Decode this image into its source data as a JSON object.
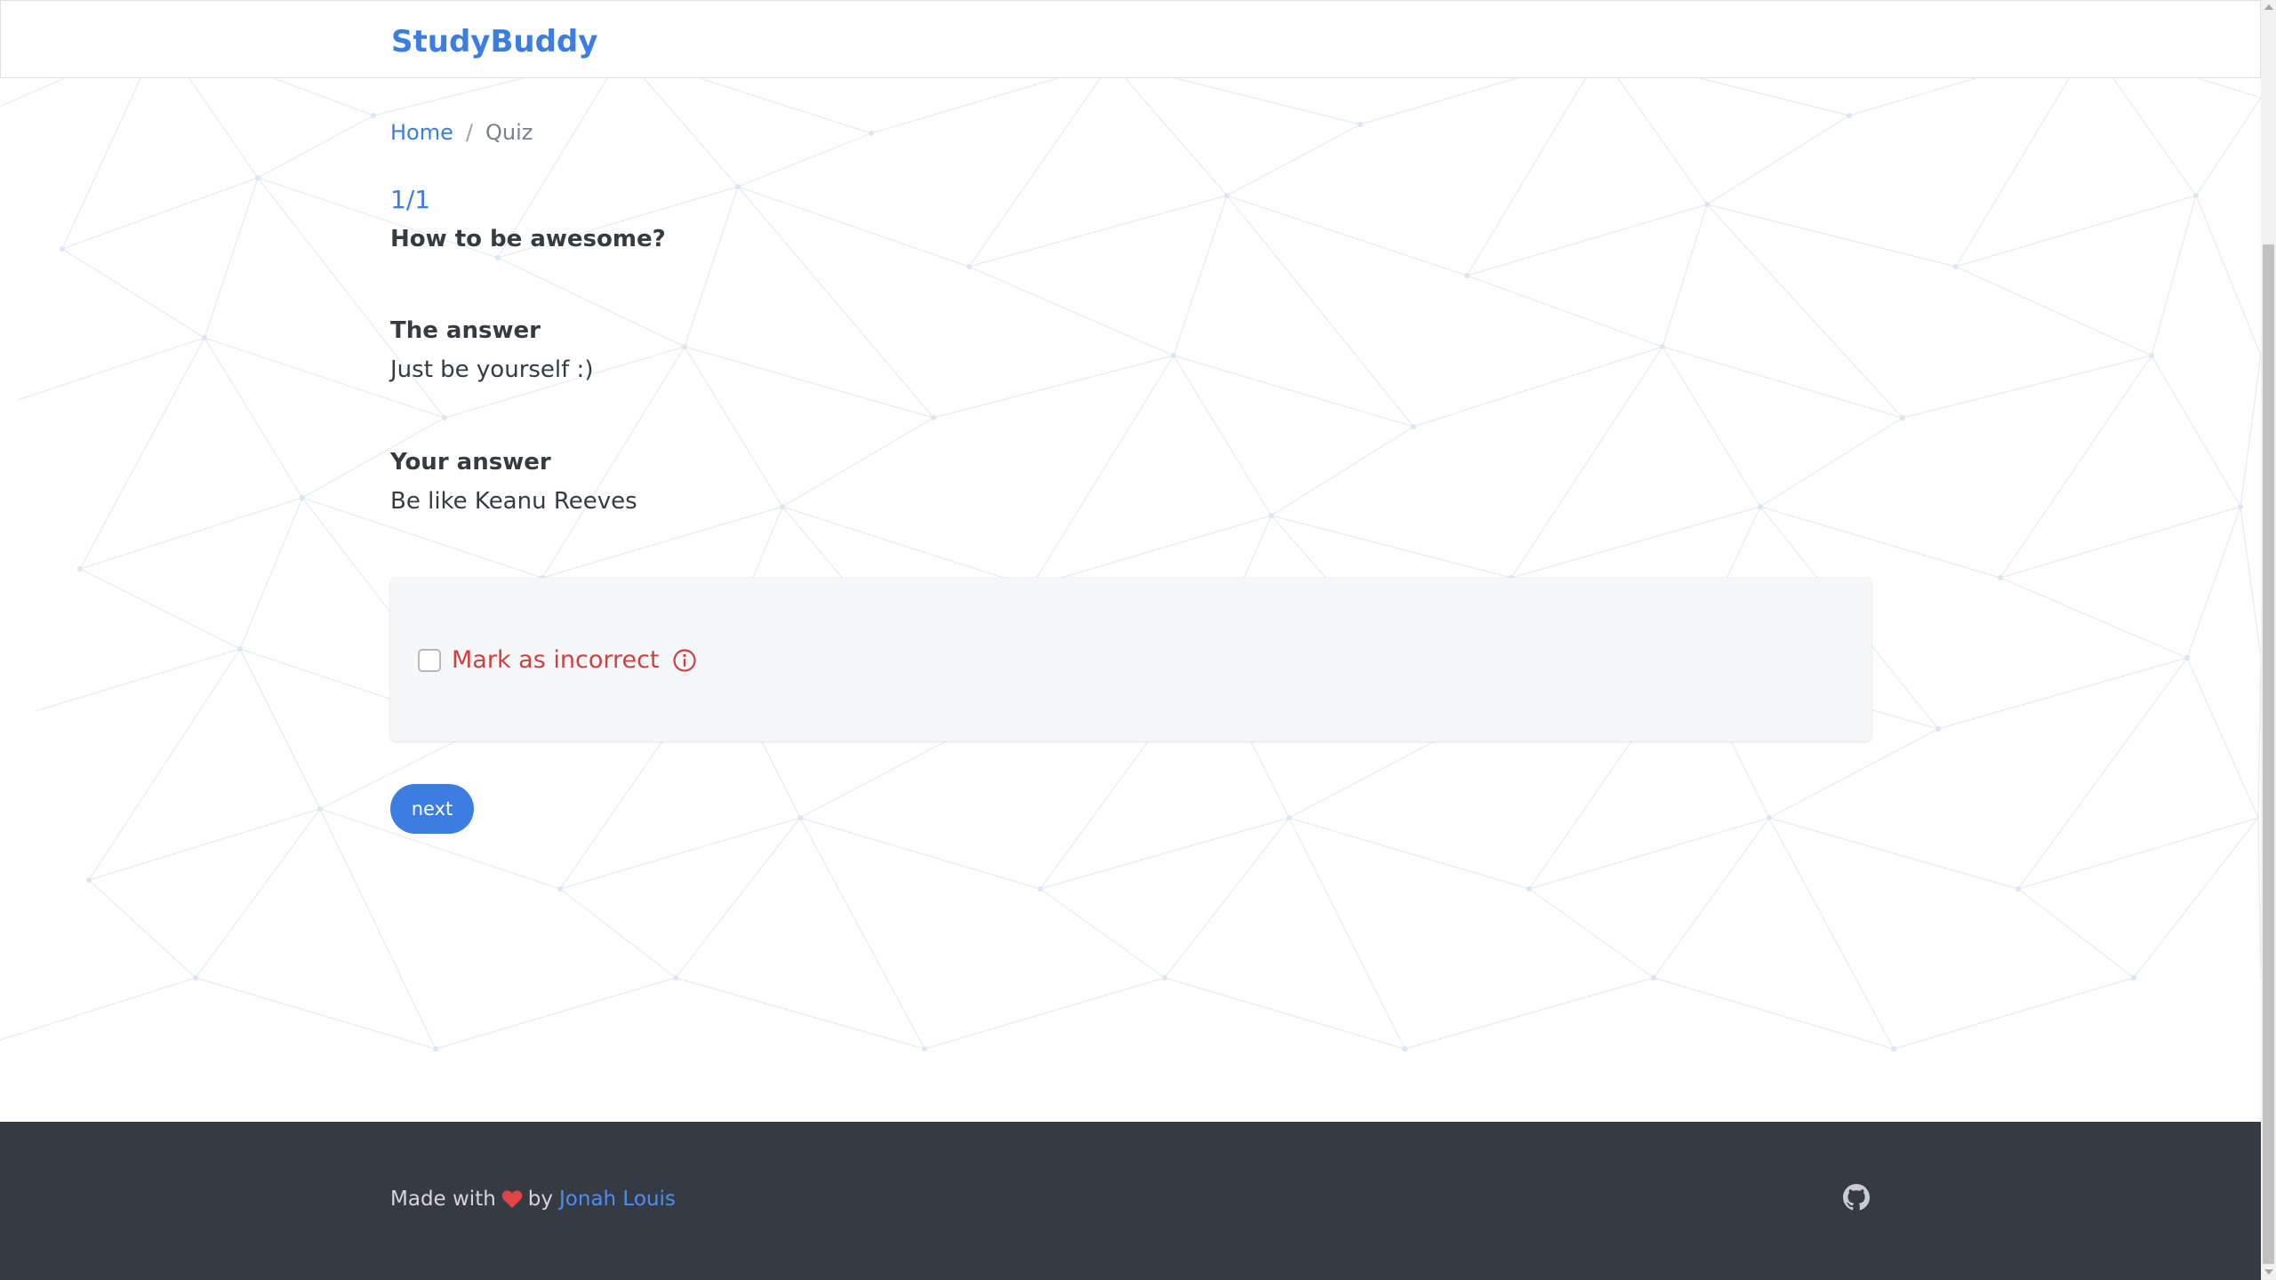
{
  "header": {
    "brand": "StudyBuddy"
  },
  "breadcrumb": {
    "home": "Home",
    "separator": "/",
    "current": "Quiz"
  },
  "quiz": {
    "progress": "1/1",
    "question": "How to be awesome?",
    "answer_label": "The answer",
    "answer_text": "Just be yourself :)",
    "your_answer_label": "Your answer",
    "your_answer_text": "Be like Keanu Reeves",
    "mark_incorrect_label": "Mark as incorrect",
    "mark_incorrect_checked": false,
    "info_icon": "info-circle-icon",
    "next_label": "next"
  },
  "footer": {
    "made_with": "Made with",
    "heart_icon": "heart-icon",
    "by": "by",
    "author": "Jonah Louis",
    "github_icon": "github-icon"
  },
  "colors": {
    "accent": "#3b7de0",
    "danger": "#cf4040",
    "footer_bg": "#363a42",
    "card_bg": "#f6f7f9",
    "text": "#363b42"
  }
}
